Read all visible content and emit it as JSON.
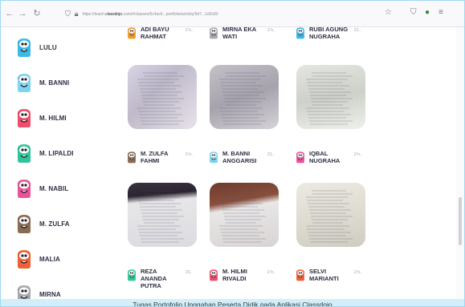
{
  "browser": {
    "url_prefix": "https://teach.",
    "url_domain": "classdojo",
    "url_suffix": ".com/#/classes/5c4ac6...portfolio/activity/5d7...1d2c83",
    "icons": [
      "back-arrow",
      "forward-arrow",
      "reload",
      "shield",
      "lock",
      "bookmark-star",
      "pocket",
      "extension",
      "menu"
    ]
  },
  "sidebar": {
    "students": [
      {
        "name": "LULU",
        "color": "#3bb9e8"
      },
      {
        "name": "M. BANNI",
        "color": "#7fd3ef"
      },
      {
        "name": "M. HILMI",
        "color": "#ef4d6b"
      },
      {
        "name": "M. LIPALDI",
        "color": "#2fc59b"
      },
      {
        "name": "M. NABIL",
        "color": "#e9539a"
      },
      {
        "name": "M. ZULFA",
        "color": "#8b6a52"
      },
      {
        "name": "MALIA",
        "color": "#f06038"
      },
      {
        "name": "MIRNA",
        "color": "#a8a8b0"
      }
    ]
  },
  "portfolio": {
    "row1": [
      {
        "name": "ADI BAYU RAHMAT",
        "time": "2 h..",
        "color": "#f39a2b"
      },
      {
        "name": "MIRNA EKA WATI",
        "time": "2 h..",
        "color": "#a8a8b0"
      },
      {
        "name": "RUBI AGUNG NUGRAHA",
        "time": "21..",
        "color": "#3bb9e8"
      }
    ],
    "row2": [
      {
        "name": "M. ZULFA FAHMI",
        "time": "2 h..",
        "color": "#8b6a52"
      },
      {
        "name": "M. BANNI ANGGARISI",
        "time": "21..",
        "color": "#7fd3ef"
      },
      {
        "name": "IQBAL NUGRAHA",
        "time": "2 h..",
        "color": "#e9539a"
      }
    ],
    "row3": [
      {
        "name": "REZA ANANDA PUTRA",
        "time": "21..",
        "color": "#2fc59b"
      },
      {
        "name": "M. HILMI RIVALDI",
        "time": "2 h..",
        "color": "#ef4d6b"
      },
      {
        "name": "SELVI MARIANTI",
        "time": "2 h..",
        "color": "#f06038"
      }
    ]
  },
  "caption": "Tugas Portofolio Unggahan Peserta Didik pada Aplikasi Classdojo"
}
